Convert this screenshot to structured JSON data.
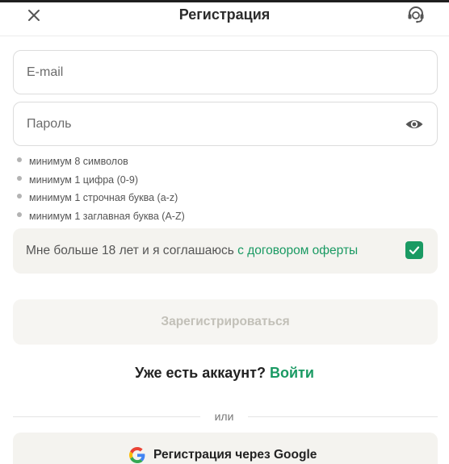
{
  "header": {
    "title": "Регистрация",
    "close_icon": "close-icon",
    "support_icon": "support-headset-icon"
  },
  "form": {
    "email": {
      "placeholder": "E-mail",
      "value": ""
    },
    "password": {
      "placeholder": "Пароль",
      "value": "",
      "toggle_icon": "eye-icon"
    },
    "rules": [
      "минимум 8 символов",
      "минимум 1 цифра (0-9)",
      "минимум 1 строчная буква (a-z)",
      "минимум 1 заглавная буква (A-Z)"
    ],
    "agreement": {
      "text": "Мне больше 18 лет и я соглашаюсь ",
      "link": "с договором оферты",
      "checked": true
    },
    "submit_label": "Зарегистрироваться"
  },
  "login": {
    "prompt": "Уже есть аккаунт? ",
    "link": "Войти"
  },
  "divider_text": "или",
  "google": {
    "label": "Регистрация через Google",
    "icon": "google-icon"
  },
  "colors": {
    "accent": "#1a9a63",
    "panel": "#f4f3ef",
    "disabled_text": "#c2c0b8"
  }
}
